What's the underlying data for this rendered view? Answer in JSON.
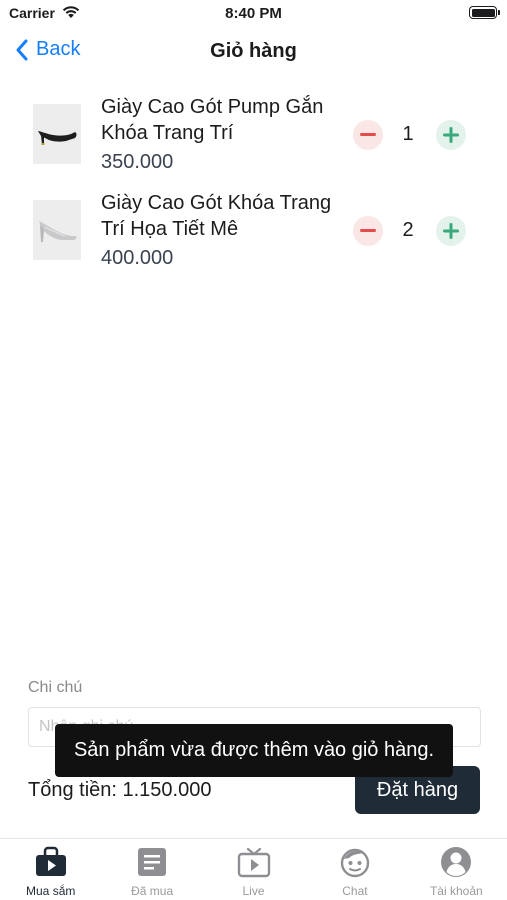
{
  "status_bar": {
    "carrier": "Carrier",
    "time": "8:40 PM"
  },
  "nav": {
    "back_label": "Back",
    "title": "Giỏ hàng"
  },
  "cart": {
    "items": [
      {
        "name": "Giày Cao Gót Pump Gắn Khóa Trang Trí",
        "price": "350.000",
        "quantity": "1",
        "thumb_icon": "black-heel-shoe"
      },
      {
        "name": "Giày Cao Gót Khóa Trang Trí Họa Tiết Mê",
        "price": "400.000",
        "quantity": "2",
        "thumb_icon": "silver-heel-shoe"
      }
    ]
  },
  "note": {
    "label": "Chi chú",
    "placeholder": "Nhập ghi chú"
  },
  "summary": {
    "total_text": "Tổng tiền: 1.150.000",
    "order_label": "Đặt hàng"
  },
  "toast": {
    "message": "Sản phẩm vừa được thêm vào giỏ hàng."
  },
  "tabs": [
    {
      "label": "Mua sắm",
      "icon": "shopping-bag-icon",
      "active": true
    },
    {
      "label": "Đã mua",
      "icon": "document-icon",
      "active": false
    },
    {
      "label": "Live",
      "icon": "tv-icon",
      "active": false
    },
    {
      "label": "Chat",
      "icon": "chat-face-icon",
      "active": false
    },
    {
      "label": "Tài khoản",
      "icon": "account-icon",
      "active": false
    }
  ],
  "colors": {
    "accent": "#147efb",
    "dark_button": "#1f2b36",
    "minus": "#e24c4c",
    "plus": "#3aa87a"
  }
}
